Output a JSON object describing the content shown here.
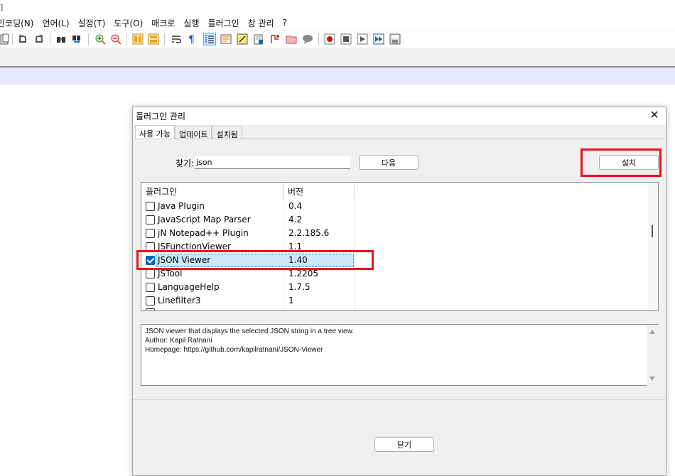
{
  "app": {
    "top_glyph": "]",
    "menu": [
      "인코딩(N)",
      "언어(L)",
      "설정(T)",
      "도구(O)",
      "매크로",
      "실행",
      "플러그인",
      "창 관리",
      "?"
    ],
    "toolbar_icons": [
      "new-file-icon",
      "undo-icon",
      "redo-icon",
      "find-icon",
      "replace-icon",
      "zoom-in-icon",
      "zoom-out-icon",
      "sync-v-icon",
      "sync-h-icon",
      "word-wrap-icon",
      "show-all-chars-icon",
      "indent-guide-icon",
      "doc-map-icon",
      "function-list-icon",
      "folder-workspace-icon",
      "monitoring-icon",
      "record-macro-icon",
      "stop-macro-icon",
      "play-macro-icon",
      "run-macro-multiple-icon",
      "save-macro-icon"
    ]
  },
  "dialog": {
    "title": "플러그인 관리",
    "tabs": [
      {
        "label": "사용 가능",
        "active": true
      },
      {
        "label": "업데이트",
        "active": false
      },
      {
        "label": "설치됨",
        "active": false
      }
    ],
    "search": {
      "label": "찾기:",
      "value": "json"
    },
    "next_button": "다음",
    "install_button": "설치",
    "list": {
      "columns": [
        "플러그인",
        "버전"
      ],
      "rows": [
        {
          "name": "Java Plugin",
          "version": "0.4",
          "checked": false
        },
        {
          "name": "JavaScript Map Parser",
          "version": "4.2",
          "checked": false
        },
        {
          "name": "jN Notepad++ Plugin",
          "version": "2.2.185.6",
          "checked": false
        },
        {
          "name": "JSFunctionViewer",
          "version": "1.1",
          "checked": false
        },
        {
          "name": "JSON Viewer",
          "version": "1.40",
          "checked": true,
          "selected": true
        },
        {
          "name": "JSTool",
          "version": "1.2205",
          "checked": false
        },
        {
          "name": "LanguageHelp",
          "version": "1.7.5",
          "checked": false
        },
        {
          "name": "Linefilter3",
          "version": "1",
          "checked": false
        }
      ]
    },
    "description": [
      "JSON viewer that displays the selected JSON string in a tree view.",
      "Author: Kapil Ratnani",
      "Homepage: https://github.com/kapilratnani/JSON-Viewer"
    ],
    "close_button": "닫기",
    "highlight_color": "#e8141a"
  }
}
